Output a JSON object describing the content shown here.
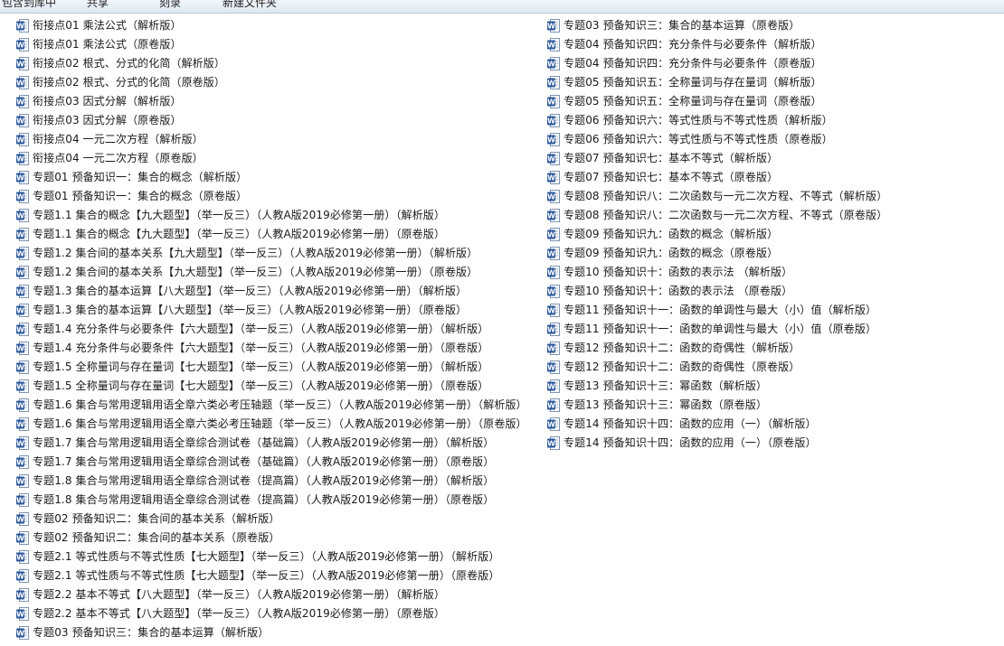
{
  "toolbar": {
    "items": [
      "包含到库中",
      "共享",
      "刻录",
      "新建文件夹"
    ]
  },
  "files": {
    "col1": [
      "衔接点01  乘法公式（解析版）",
      "衔接点01  乘法公式（原卷版）",
      "衔接点02  根式、分式的化简（解析版）",
      "衔接点02  根式、分式的化简（原卷版）",
      "衔接点03  因式分解（解析版）",
      "衔接点03  因式分解（原卷版）",
      "衔接点04  一元二次方程（解析版）",
      "衔接点04  一元二次方程（原卷版）",
      "专题01 预备知识一：集合的概念（解析版）",
      "专题01 预备知识一：集合的概念（原卷版）",
      "专题1.1 集合的概念【九大题型】（举一反三）（人教A版2019必修第一册）（解析版）",
      "专题1.1 集合的概念【九大题型】（举一反三）（人教A版2019必修第一册）（原卷版）",
      "专题1.2 集合间的基本关系【九大题型】（举一反三）（人教A版2019必修第一册）（解析版）",
      "专题1.2 集合间的基本关系【九大题型】（举一反三）（人教A版2019必修第一册）（原卷版）",
      "专题1.3 集合的基本运算【八大题型】（举一反三）（人教A版2019必修第一册）（解析版）",
      "专题1.3 集合的基本运算【八大题型】（举一反三）（人教A版2019必修第一册）（原卷版）",
      "专题1.4 充分条件与必要条件【六大题型】（举一反三）（人教A版2019必修第一册）（解析版）",
      "专题1.4 充分条件与必要条件【六大题型】（举一反三）（人教A版2019必修第一册）（原卷版）",
      "专题1.5 全称量词与存在量词【七大题型】（举一反三）（人教A版2019必修第一册）（解析版）",
      "专题1.5 全称量词与存在量词【七大题型】（举一反三）（人教A版2019必修第一册）（原卷版）",
      "专题1.6 集合与常用逻辑用语全章六类必考压轴题（举一反三）（人教A版2019必修第一册）（解析版）",
      "专题1.6 集合与常用逻辑用语全章六类必考压轴题（举一反三）（人教A版2019必修第一册）（原卷版）",
      "专题1.7 集合与常用逻辑用语全章综合测试卷（基础篇）（人教A版2019必修第一册）（解析版）",
      "专题1.7 集合与常用逻辑用语全章综合测试卷（基础篇）（人教A版2019必修第一册）（原卷版）",
      "专题1.8 集合与常用逻辑用语全章综合测试卷（提高篇）（人教A版2019必修第一册）（解析版）",
      "专题1.8 集合与常用逻辑用语全章综合测试卷（提高篇）（人教A版2019必修第一册）（原卷版）",
      "专题02 预备知识二：集合间的基本关系（解析版）",
      "专题02 预备知识二：集合间的基本关系（原卷版）",
      "专题2.1 等式性质与不等式性质【七大题型】（举一反三）（人教A版2019必修第一册）（解析版）",
      "专题2.1 等式性质与不等式性质【七大题型】（举一反三）（人教A版2019必修第一册）（原卷版）",
      "专题2.2 基本不等式【八大题型】（举一反三）（人教A版2019必修第一册）（解析版）",
      "专题2.2 基本不等式【八大题型】（举一反三）（人教A版2019必修第一册）（原卷版）",
      "专题03 预备知识三：集合的基本运算（解析版）"
    ],
    "col2": [
      "专题03 预备知识三：集合的基本运算（原卷版）",
      "专题04 预备知识四：充分条件与必要条件（解析版）",
      "专题04 预备知识四：充分条件与必要条件（原卷版）",
      "专题05 预备知识五：全称量词与存在量词（解析版）",
      "专题05 预备知识五：全称量词与存在量词（原卷版）",
      "专题06 预备知识六：等式性质与不等式性质（解析版）",
      "专题06 预备知识六：等式性质与不等式性质（原卷版）",
      "专题07 预备知识七：基本不等式（解析版）",
      "专题07 预备知识七：基本不等式（原卷版）",
      "专题08 预备知识八：二次函数与一元二次方程、不等式（解析版）",
      "专题08 预备知识八：二次函数与一元二次方程、不等式（原卷版）",
      "专题09 预备知识九：函数的概念（解析版）",
      "专题09 预备知识九：函数的概念（原卷版）",
      "专题10 预备知识十：函数的表示法 （解析版）",
      "专题10 预备知识十：函数的表示法 （原卷版）",
      "专题11 预备知识十一：函数的单调性与最大（小）值（解析版）",
      "专题11 预备知识十一：函数的单调性与最大（小）值（原卷版）",
      "专题12 预备知识十二：函数的奇偶性（解析版）",
      "专题12 预备知识十二：函数的奇偶性（原卷版）",
      "专题13 预备知识十三：幂函数（解析版）",
      "专题13 预备知识十三：幂函数（原卷版）",
      "专题14 预备知识十四：函数的应用（一）（解析版）",
      "专题14 预备知识十四：函数的应用（一）（原卷版）"
    ]
  },
  "icon": {
    "name": "word-doc-icon",
    "color": "#2b579a"
  }
}
